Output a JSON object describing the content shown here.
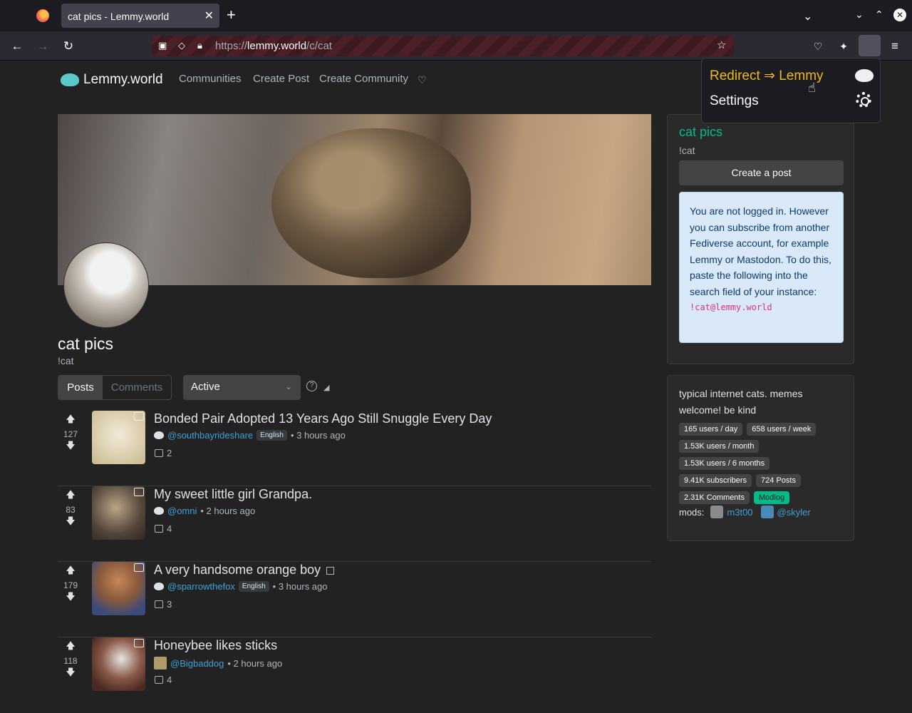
{
  "browser": {
    "tab_title": "cat pics - Lemmy.world",
    "tab_close": "✕",
    "new_tab": "+",
    "url_host": "lemmy.world",
    "url_prefix": "https://",
    "url_path": "/c/cat"
  },
  "site": {
    "brand": "Lemmy.world",
    "nav": [
      "Communities",
      "Create Post",
      "Create Community"
    ]
  },
  "community": {
    "title": "cat pics",
    "handle": "!cat"
  },
  "controls": {
    "tabs": [
      "Posts",
      "Comments"
    ],
    "sort": "Active"
  },
  "posts": [
    {
      "score": "127",
      "title": "Bonded Pair Adopted 13 Years Ago Still Snuggle Every Day",
      "user": "@southbayrideshare",
      "lang": "English",
      "time": "• 3 hours ago",
      "comments": "2",
      "thumb_color": "#d8ccb0"
    },
    {
      "score": "83",
      "title": "My sweet little girl Grandpa.",
      "user": "@omni",
      "lang": "",
      "time": "• 2 hours ago",
      "comments": "4",
      "thumb_color": "#6a5a48"
    },
    {
      "score": "179",
      "title": "A very handsome orange boy",
      "user": "@sparrowthefox",
      "lang": "English",
      "time": "• 3 hours ago",
      "comments": "3",
      "thumb_color": "#a86a38"
    },
    {
      "score": "118",
      "title": "Honeybee likes sticks",
      "user": "@Bigbaddog",
      "lang": "",
      "time": "• 2 hours ago",
      "comments": "4",
      "thumb_color": "#7a4a3a"
    }
  ],
  "sidebar": {
    "title": "cat pics",
    "handle": "!cat",
    "create_post": "Create a post",
    "info": "You are not logged in. However you can subscribe from another Fediverse account, for example Lemmy or Mastodon. To do this, paste the following into the search field of your instance:",
    "info_code": "!cat@lemmy.world",
    "description": "typical internet cats. memes welcome! be kind",
    "stats": [
      "165 users / day",
      "658 users / week",
      "1.53K users / month",
      "1.53K users / 6 months",
      "9.41K subscribers",
      "724 Posts",
      "2.31K Comments"
    ],
    "modlog": "Modlog",
    "mods_label": "mods:",
    "mods": [
      "m3t00",
      "@skyler"
    ]
  },
  "popup": {
    "redirect": "Redirect ⇒ Lemmy",
    "settings": "Settings"
  },
  "colors": {
    "accent": "#00bc8c",
    "link": "#3ea1d6",
    "popup_highlight": "#f0b917"
  }
}
